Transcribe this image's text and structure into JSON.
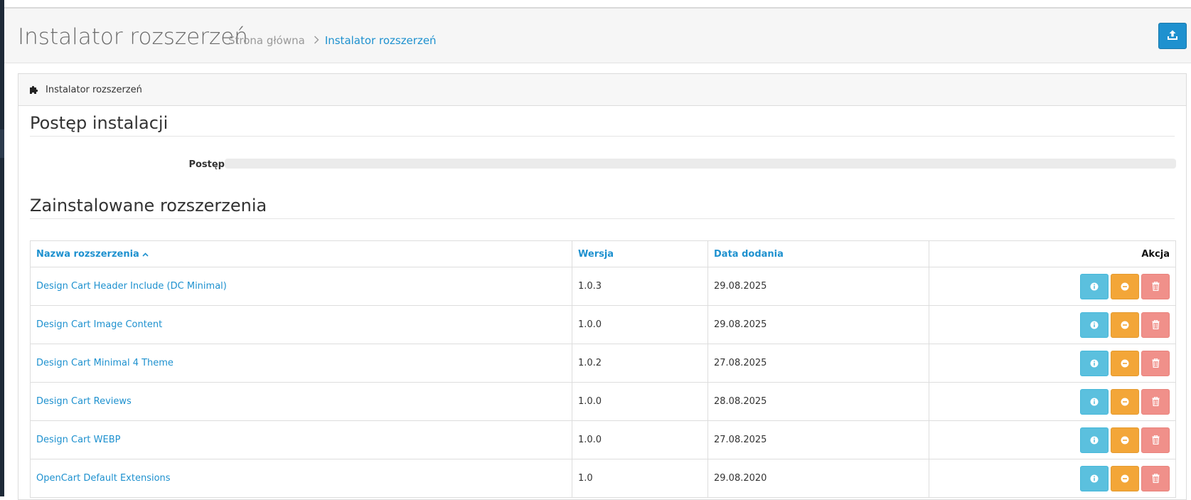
{
  "header": {
    "title": "Instalator rozszerzeń",
    "breadcrumb": [
      {
        "label": "Strona główna"
      },
      {
        "label": "Instalator rozszerzeń"
      }
    ],
    "upload_icon": "upload-icon"
  },
  "panel": {
    "heading": "Instalator rozszerzeń",
    "heading_icon": "puzzle-icon",
    "progress_section_title": "Postęp instalacji",
    "progress_label": "Postęp",
    "progress_value": 0,
    "installed_section_title": "Zainstalowane rozszerzenia"
  },
  "table": {
    "columns": {
      "name": "Nazwa rozszerzenia",
      "version": "Wersja",
      "date": "Data dodania",
      "action": "Akcja"
    },
    "rows": [
      {
        "name": "Design Cart Header Include (DC Minimal)",
        "version": "1.0.3",
        "date": "29.08.2025"
      },
      {
        "name": "Design Cart Image Content",
        "version": "1.0.0",
        "date": "29.08.2025"
      },
      {
        "name": "Design Cart Minimal 4 Theme",
        "version": "1.0.2",
        "date": "27.08.2025"
      },
      {
        "name": "Design Cart Reviews",
        "version": "1.0.0",
        "date": "28.08.2025"
      },
      {
        "name": "Design Cart WEBP",
        "version": "1.0.0",
        "date": "27.08.2025"
      },
      {
        "name": "OpenCart Default Extensions",
        "version": "1.0",
        "date": "29.08.2020"
      }
    ]
  },
  "colors": {
    "primary": "#1e91cf",
    "info": "#5bc0de",
    "warning": "#f3a638",
    "danger": "#f0908a"
  }
}
